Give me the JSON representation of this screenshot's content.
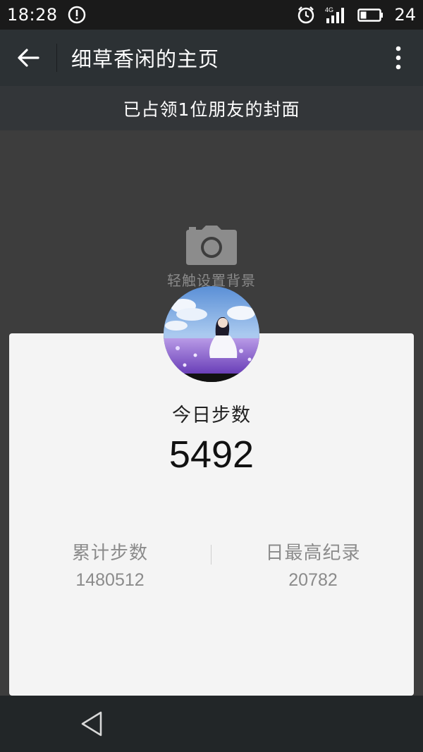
{
  "status_bar": {
    "time": "18:28",
    "network": "4G",
    "battery": "24",
    "icons": [
      "alert-icon",
      "alarm-icon",
      "signal-icon",
      "battery-icon"
    ]
  },
  "toolbar": {
    "title": "细草香闲的主页",
    "back_icon": "arrow-left-icon",
    "more_icon": "more-vertical-icon"
  },
  "banner": {
    "text": "已占领1位朋友的封面"
  },
  "cover": {
    "camera_icon": "camera-icon",
    "hint": "轻触设置背景"
  },
  "stats": {
    "today_label": "今日步数",
    "today_value": "5492",
    "total_label": "累计步数",
    "total_value": "1480512",
    "record_label": "日最高纪录",
    "record_value": "20782"
  },
  "nav": {
    "back_icon": "triangle-back-icon"
  },
  "colors": {
    "toolbar_bg": "#2c3134",
    "banner_bg": "#333639",
    "cover_bg": "#3d3d3d",
    "card_bg": "#f4f4f4",
    "muted_text": "#8b8b8b"
  }
}
